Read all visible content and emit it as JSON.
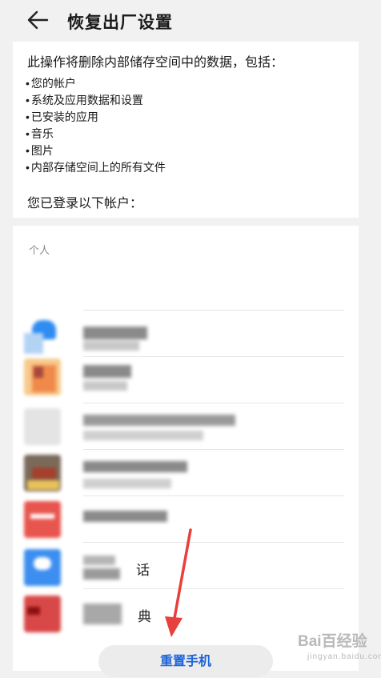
{
  "header": {
    "title": "恢复出厂设置"
  },
  "info": {
    "intro": "此操作将删除内部储存空间中的数据，包括：",
    "items": [
      "您的帐户",
      "系统及应用数据和设置",
      "已安装的应用",
      "音乐",
      "图片",
      "内部存储空间上的所有文件"
    ],
    "logged_in": "您已登录以下帐户："
  },
  "accounts": {
    "section_label": "个人",
    "items": [
      {
        "icon_color": "#2f8cf0",
        "partial_text": ""
      },
      {
        "icon_color": "#f2a35c",
        "partial_text": ""
      },
      {
        "icon_color": "#d6d6d6",
        "partial_text": ""
      },
      {
        "icon_color": "#8b5a3c",
        "partial_text": ""
      },
      {
        "icon_color": "#e8554e",
        "partial_text": ""
      },
      {
        "icon_color": "#3c8ef0",
        "partial_text": "话"
      },
      {
        "icon_color": "#d94848",
        "partial_text": "典"
      }
    ]
  },
  "actions": {
    "reset_label": "重置手机"
  },
  "watermark": {
    "brand": "Bai百经验",
    "sub": "jingyan.baidu.com"
  },
  "colors": {
    "accent": "#1b64d8",
    "arrow": "#e8403c",
    "background": "#f1f1f1"
  }
}
